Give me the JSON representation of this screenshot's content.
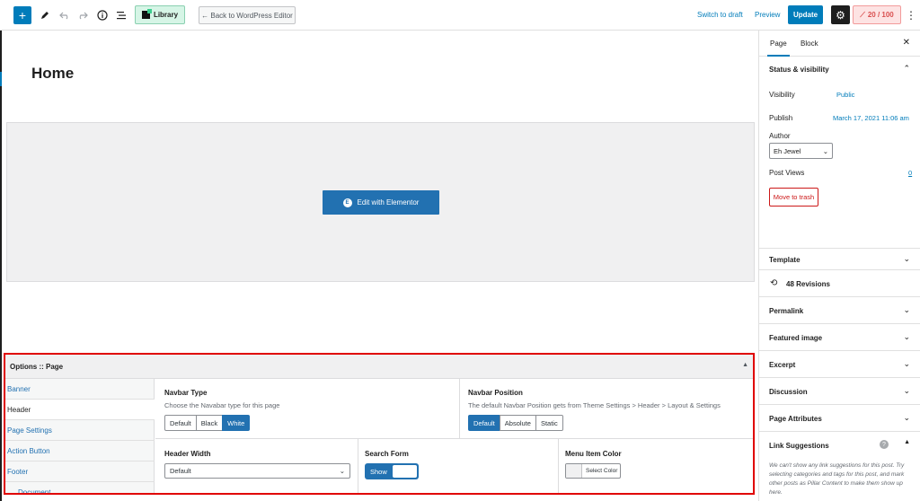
{
  "toolbar": {
    "add_symbol": "+",
    "library_label": "Library",
    "back_label": "← Back to WordPress Editor",
    "switch_draft": "Switch to draft",
    "preview": "Preview",
    "update": "Update",
    "score_label": "20 / 100"
  },
  "editor": {
    "page_title": "Home",
    "elementor_button": "Edit with Elementor",
    "elementor_icon_letter": "E"
  },
  "options": {
    "title": "Options :: Page",
    "tabs": [
      "Banner",
      "Header",
      "Page Settings",
      "Action Button",
      "Footer",
      "Document"
    ],
    "navbar_type": {
      "title": "Navbar Type",
      "desc": "Choose the Navabar type for this page",
      "options": [
        "Default",
        "Black",
        "White"
      ],
      "selected": "White"
    },
    "navbar_position": {
      "title": "Navbar Position",
      "desc": "The default Navbar Position gets from Theme Settings > Header > Layout & Settings",
      "options": [
        "Default",
        "Absolute",
        "Static"
      ],
      "selected": "Default"
    },
    "header_width": {
      "title": "Header Width",
      "value": "Default"
    },
    "search_form": {
      "title": "Search Form",
      "value": "Show"
    },
    "menu_item_color": {
      "title": "Menu Item Color",
      "button": "Select Color"
    }
  },
  "sidebar": {
    "tabs": [
      "Page",
      "Block"
    ],
    "status": {
      "title": "Status & visibility",
      "visibility_label": "Visibility",
      "visibility_value": "Public",
      "publish_label": "Publish",
      "publish_value": "March 17, 2021 11:06 am",
      "author_label": "Author",
      "author_value": "Eh Jewel",
      "views_label": "Post Views",
      "views_value": "0",
      "trash": "Move to trash"
    },
    "sections": [
      "Template",
      "48 Revisions",
      "Permalink",
      "Featured image",
      "Excerpt",
      "Discussion",
      "Page Attributes",
      "Link Suggestions"
    ],
    "link_suggestions_desc": "We can't show any link suggestions for this post. Try selecting categories and tags for this post, and mark other posts as Pillar Content to make them show up here."
  },
  "colors": {
    "accent": "#007cba",
    "highlight_border": "#e00000",
    "score_red": "#d94f4f"
  }
}
